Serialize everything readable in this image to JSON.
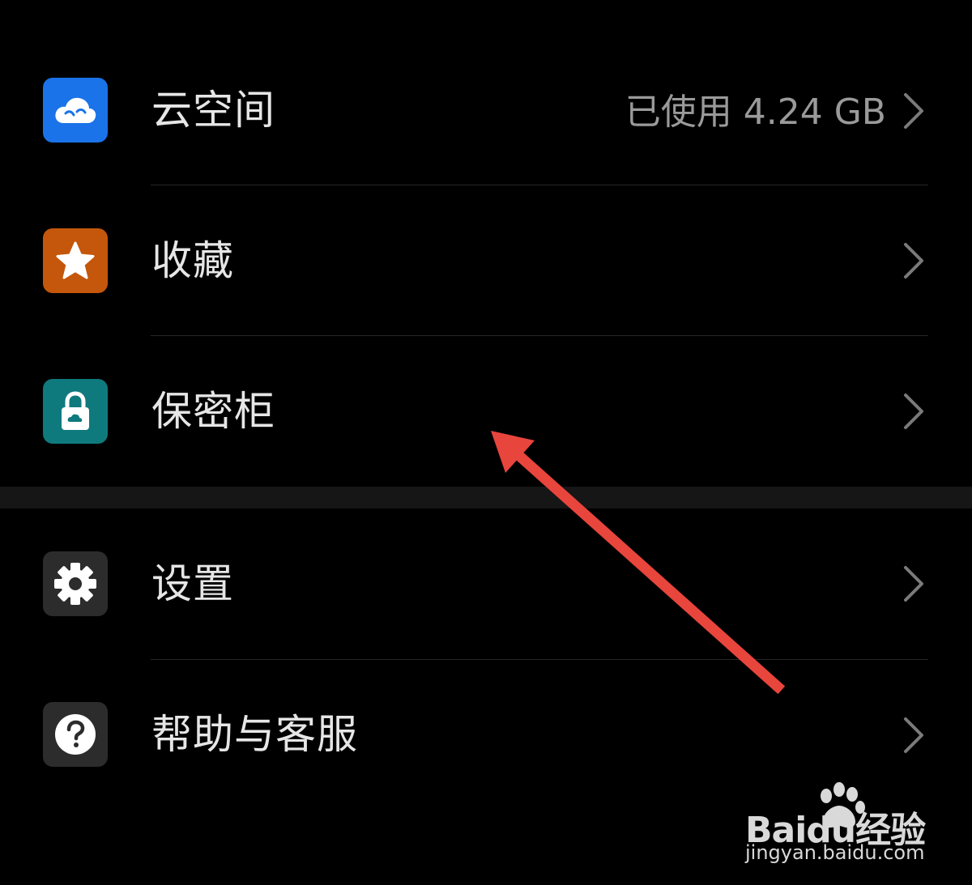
{
  "menu": {
    "items": [
      {
        "label": "云空间",
        "value": "已使用 4.24 GB",
        "icon": "cloud-icon",
        "icon_bg": "#1a73e8"
      },
      {
        "label": "收藏",
        "value": "",
        "icon": "star-icon",
        "icon_bg": "#c4570b"
      },
      {
        "label": "保密柜",
        "value": "",
        "icon": "lock-icon",
        "icon_bg": "#0f7a7e"
      },
      {
        "label": "设置",
        "value": "",
        "icon": "gear-icon",
        "icon_bg": "#2c2c2c"
      },
      {
        "label": "帮助与客服",
        "value": "",
        "icon": "help-icon",
        "icon_bg": "#2c2c2c"
      }
    ]
  },
  "annotation": {
    "arrow_color": "#e8453c"
  },
  "watermark": {
    "brand": "Baidu经验",
    "domain": "jingyan.baidu.com"
  }
}
